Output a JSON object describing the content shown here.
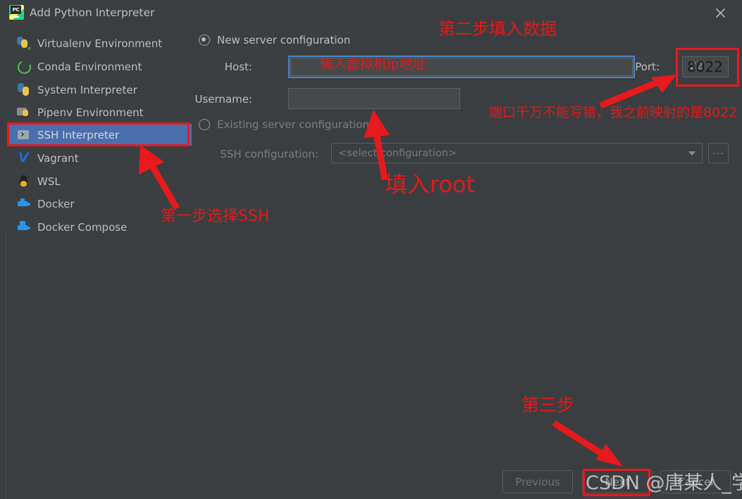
{
  "window": {
    "title": "Add Python Interpreter",
    "app_icon": "pycharm-icon",
    "close_icon": "close-icon"
  },
  "sidebar": {
    "items": [
      {
        "label": "Virtualenv Environment",
        "icon": "virtualenv-icon",
        "selected": false
      },
      {
        "label": "Conda Environment",
        "icon": "conda-icon",
        "selected": false
      },
      {
        "label": "System Interpreter",
        "icon": "python-icon",
        "selected": false
      },
      {
        "label": "Pipenv Environment",
        "icon": "pipenv-icon",
        "selected": false
      },
      {
        "label": "SSH Interpreter",
        "icon": "ssh-icon",
        "selected": true
      },
      {
        "label": "Vagrant",
        "icon": "vagrant-icon",
        "selected": false
      },
      {
        "label": "WSL",
        "icon": "linux-penguin-icon",
        "selected": false
      },
      {
        "label": "Docker",
        "icon": "docker-icon",
        "selected": false
      },
      {
        "label": "Docker Compose",
        "icon": "docker-compose-icon",
        "selected": false
      }
    ]
  },
  "form": {
    "new_server": {
      "radio_label": "New server configuration",
      "selected": true,
      "host_label": "Host:",
      "host_value": "",
      "port_label": "Port:",
      "port_value": "22",
      "port_typed_value": "8022",
      "username_label": "Username:",
      "username_value": ""
    },
    "existing_server": {
      "radio_label": "Existing server configuration",
      "selected": false,
      "ssh_config_label": "SSH configuration:",
      "ssh_config_placeholder": "<select configuration>",
      "browse_label": "..."
    }
  },
  "footer": {
    "previous_label": "Previous",
    "next_label": "Next",
    "cancel_label": "Cancel"
  },
  "annotations": [
    {
      "id": "step2",
      "text": "第二步填入数据"
    },
    {
      "id": "host-hint",
      "text": "输入虚拟机ip地址"
    },
    {
      "id": "port-warning",
      "text": "端口千万不能写错，我之前映射的是8022"
    },
    {
      "id": "username-hint",
      "text": "填入root"
    },
    {
      "id": "step1",
      "text": "第一步选择SSH"
    },
    {
      "id": "step3",
      "text": "第三步"
    }
  ],
  "watermark": {
    "text": "CSDN @唐某人_学测试"
  },
  "colors": {
    "background": "#3c3f41",
    "selection": "#4b6eaf",
    "annotation_red": "#e01b1b",
    "box_red": "#e8191c",
    "focus_blue": "#4a88c7",
    "text": "#bdbdbd",
    "text_dim": "#7a7d80"
  }
}
